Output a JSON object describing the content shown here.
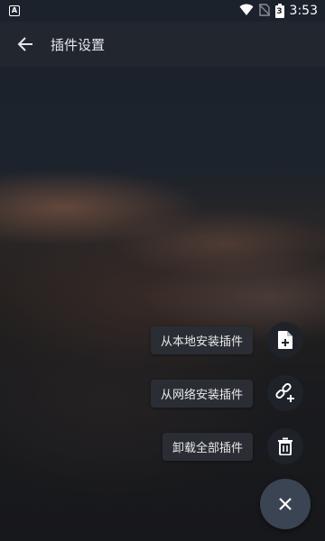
{
  "status_bar": {
    "notification_icon": "A",
    "time": "3:53",
    "battery_level": "3",
    "icons": [
      "wifi-icon",
      "no-sim-icon",
      "battery-icon"
    ]
  },
  "app_bar": {
    "back_icon": "arrow-left-icon",
    "title": "插件设置"
  },
  "actions": [
    {
      "label": "从本地安装插件",
      "icon": "file-plus-icon"
    },
    {
      "label": "从网络安装插件",
      "icon": "link-plus-icon"
    },
    {
      "label": "卸载全部插件",
      "icon": "trash-icon"
    }
  ],
  "main_fab": {
    "icon": "close-icon"
  },
  "colors": {
    "app_bar_bg": "#22272f",
    "label_bg": "#2a2e34",
    "fab_bg": "#3a4452",
    "icon": "#ffffff"
  }
}
